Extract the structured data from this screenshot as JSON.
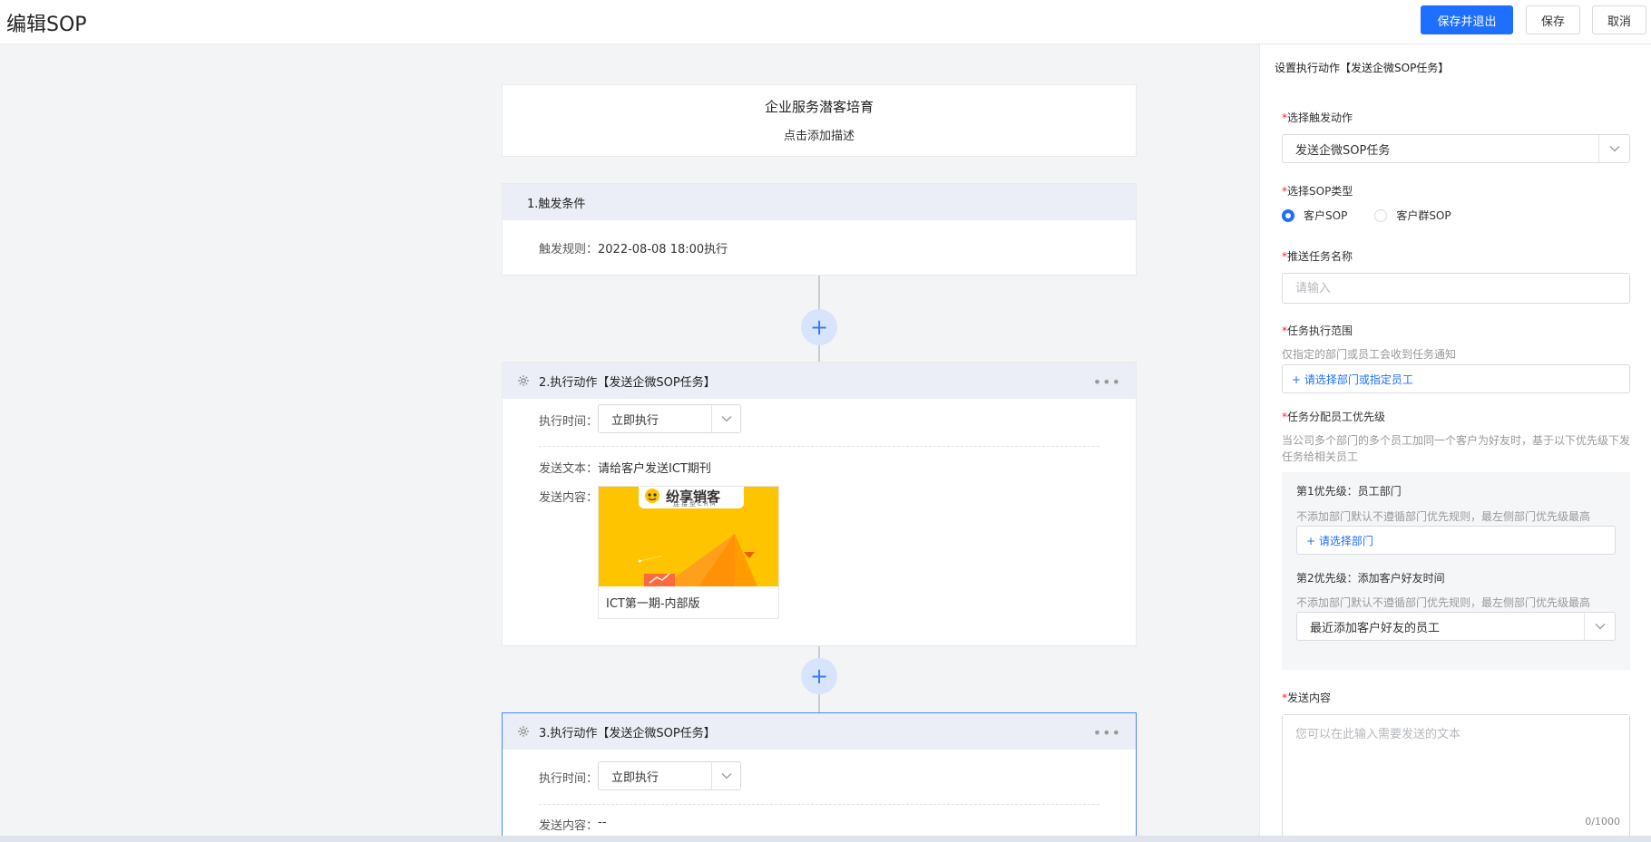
{
  "header": {
    "title": "编辑SOP",
    "save_exit_label": "保存并退出",
    "save_label": "保存",
    "cancel_label": "取消"
  },
  "canvas": {
    "title": "企业服务潜客培育",
    "description": "点击添加描述",
    "trigger": {
      "heading": "1.触发条件",
      "rule_label": "触发规则：",
      "rule_value": "2022-08-08 18:00执行"
    },
    "actions": [
      {
        "heading": "2.执行动作【发送企微SOP任务】",
        "exec_time_label": "执行时间：",
        "exec_time_value": "立即执行",
        "send_text_label": "发送文本：",
        "send_text_value": "请给客户发送ICT期刊",
        "send_content_label": "发送内容：",
        "media_logo": "纷享销客",
        "media_logo_sub": "连接型CRM",
        "media_caption": "ICT第一期-内部版"
      },
      {
        "heading": "3.执行动作【发送企微SOP任务】",
        "exec_time_label": "执行时间：",
        "exec_time_value": "立即执行",
        "send_content_label": "发送内容：",
        "send_content_value": "--"
      }
    ],
    "more_glyph": "•••",
    "plus_glyph": "+"
  },
  "panel": {
    "title": "设置执行动作【发送企微SOP任务】",
    "trigger_action": {
      "label": "选择触发动作",
      "value": "发送企微SOP任务"
    },
    "sop_type": {
      "label": "选择SOP类型",
      "options": [
        "客户SOP",
        "客户群SOP"
      ],
      "selected": "客户SOP"
    },
    "task_name": {
      "label": "推送任务名称",
      "placeholder": "请输入"
    },
    "scope": {
      "label": "任务执行范围",
      "hint": "仅指定的部门或员工会收到任务通知",
      "link": "+ 请选择部门或指定员工"
    },
    "priority": {
      "label": "任务分配员工优先级",
      "hint": "当公司多个部门的多个员工加同一个客户为好友时，基于以下优先级下发任务给相关员工",
      "p1_title": "第1优先级：员工部门",
      "p1_hint": "不添加部门默认不遵循部门优先规则，最左侧部门优先级最高",
      "p1_link": "+ 请选择部门",
      "p2_title": "第2优先级：添加客户好友时间",
      "p2_hint": "不添加部门默认不遵循部门优先规则，最左侧部门优先级最高",
      "p2_value": "最近添加客户好友的员工"
    },
    "content": {
      "label": "发送内容",
      "placeholder": "您可以在此输入需要发送的文本",
      "counter": "0/1000"
    },
    "required_mark": "*"
  },
  "colors": {
    "primary": "#1e6fff",
    "node_header": "#ebeef6",
    "plus_bg": "#d7e4fb",
    "required": "#f5222d",
    "media_bg": "#ffc400"
  },
  "icons": {
    "gear": "gear-icon",
    "chevron": "chevron-down-icon",
    "plus": "plus-icon",
    "more": "more-icon"
  }
}
